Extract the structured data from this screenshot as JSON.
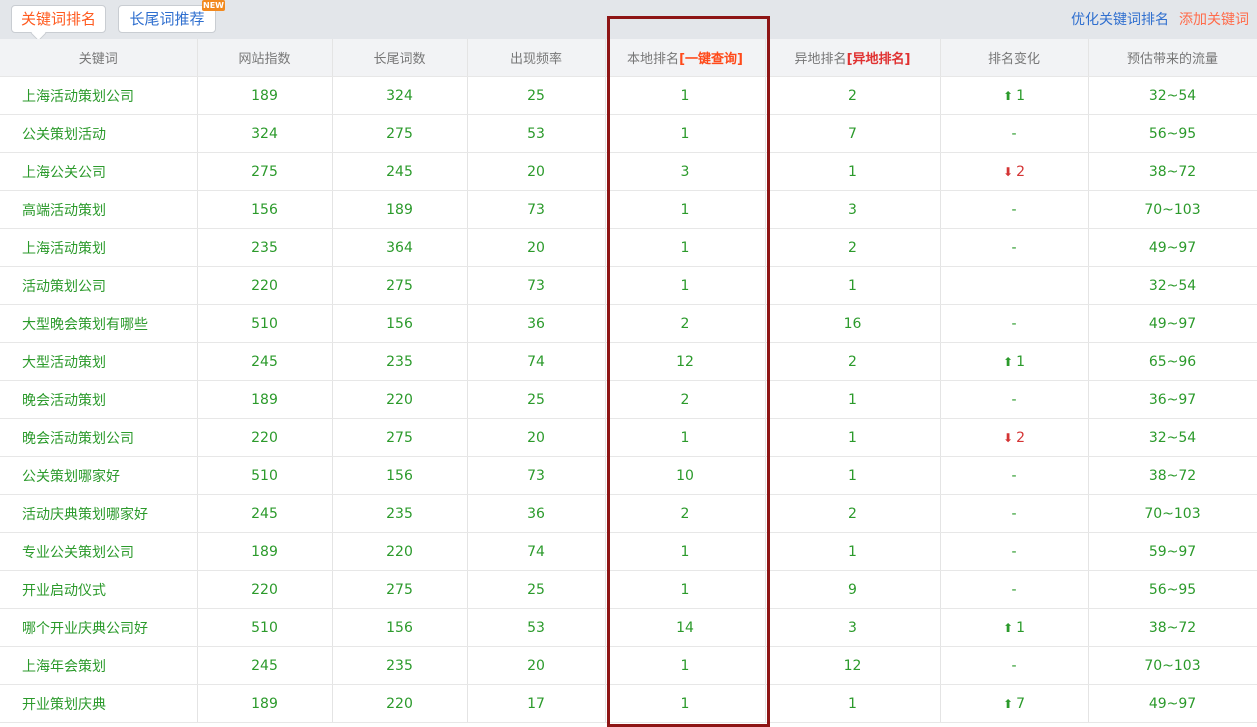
{
  "tabs": [
    "关键词排名",
    "长尾词推荐"
  ],
  "new_badge": "NEW",
  "top_links": {
    "optimize": "优化关键词排名",
    "add": "添加关键词"
  },
  "columns": [
    "关键词",
    "网站指数",
    "长尾词数",
    "出现频率",
    "本地排名",
    "[一键查询]",
    "异地排名",
    "[异地排名]",
    "排名变化",
    "预估带来的流量"
  ],
  "rows": [
    {
      "kw": "上海活动策划公司",
      "idx": "189",
      "tail": "324",
      "freq": "25",
      "local": "1",
      "remote": "2",
      "change": "1",
      "dir": "up",
      "traffic": "32~54"
    },
    {
      "kw": "公关策划活动",
      "idx": "324",
      "tail": "275",
      "freq": "53",
      "local": "1",
      "remote": "7",
      "change": "-",
      "dir": "none",
      "traffic": "56~95"
    },
    {
      "kw": "上海公关公司",
      "idx": "275",
      "tail": "245",
      "freq": "20",
      "local": "3",
      "remote": "1",
      "change": "2",
      "dir": "down",
      "traffic": "38~72"
    },
    {
      "kw": "高端活动策划",
      "idx": "156",
      "tail": "189",
      "freq": "73",
      "local": "1",
      "remote": "3",
      "change": "-",
      "dir": "none",
      "traffic": "70~103"
    },
    {
      "kw": "上海活动策划",
      "idx": "235",
      "tail": "364",
      "freq": "20",
      "local": "1",
      "remote": "2",
      "change": "-",
      "dir": "none",
      "traffic": "49~97"
    },
    {
      "kw": "活动策划公司",
      "idx": "220",
      "tail": "275",
      "freq": "73",
      "local": "1",
      "remote": "1",
      "change": "",
      "dir": "none",
      "traffic": "32~54"
    },
    {
      "kw": "大型晚会策划有哪些",
      "idx": "510",
      "tail": "156",
      "freq": "36",
      "local": "2",
      "remote": "16",
      "change": "-",
      "dir": "none",
      "traffic": "49~97"
    },
    {
      "kw": "大型活动策划",
      "idx": "245",
      "tail": "235",
      "freq": "74",
      "local": "12",
      "remote": "2",
      "change": "1",
      "dir": "up",
      "traffic": "65~96"
    },
    {
      "kw": "晚会活动策划",
      "idx": "189",
      "tail": "220",
      "freq": "25",
      "local": "2",
      "remote": "1",
      "change": "-",
      "dir": "none",
      "traffic": "36~97"
    },
    {
      "kw": "晚会活动策划公司",
      "idx": "220",
      "tail": "275",
      "freq": "20",
      "local": "1",
      "remote": "1",
      "change": "2",
      "dir": "down",
      "traffic": "32~54"
    },
    {
      "kw": "公关策划哪家好",
      "idx": "510",
      "tail": "156",
      "freq": "73",
      "local": "10",
      "remote": "1",
      "change": "-",
      "dir": "none",
      "traffic": "38~72"
    },
    {
      "kw": "活动庆典策划哪家好",
      "idx": "245",
      "tail": "235",
      "freq": "36",
      "local": "2",
      "remote": "2",
      "change": "-",
      "dir": "none",
      "traffic": "70~103"
    },
    {
      "kw": "专业公关策划公司",
      "idx": "189",
      "tail": "220",
      "freq": "74",
      "local": "1",
      "remote": "1",
      "change": "-",
      "dir": "none",
      "traffic": "59~97"
    },
    {
      "kw": "开业启动仪式",
      "idx": "220",
      "tail": "275",
      "freq": "25",
      "local": "1",
      "remote": "9",
      "change": "-",
      "dir": "none",
      "traffic": "56~95"
    },
    {
      "kw": "哪个开业庆典公司好",
      "idx": "510",
      "tail": "156",
      "freq": "53",
      "local": "14",
      "remote": "3",
      "change": "1",
      "dir": "up",
      "traffic": "38~72"
    },
    {
      "kw": "上海年会策划",
      "idx": "245",
      "tail": "235",
      "freq": "20",
      "local": "1",
      "remote": "12",
      "change": "-",
      "dir": "none",
      "traffic": "70~103"
    },
    {
      "kw": "开业策划庆典",
      "idx": "189",
      "tail": "220",
      "freq": "17",
      "local": "1",
      "remote": "1",
      "change": "7",
      "dir": "up",
      "traffic": "49~97"
    }
  ],
  "colors": {
    "accent": "#ff5a1f",
    "link_blue": "#2f6fcf",
    "value_green": "#2b9a2b",
    "down_red": "#d43434",
    "highlight_box": "#8e1515"
  },
  "icons": {
    "up": "arrow-up-icon",
    "down": "arrow-down-icon"
  }
}
